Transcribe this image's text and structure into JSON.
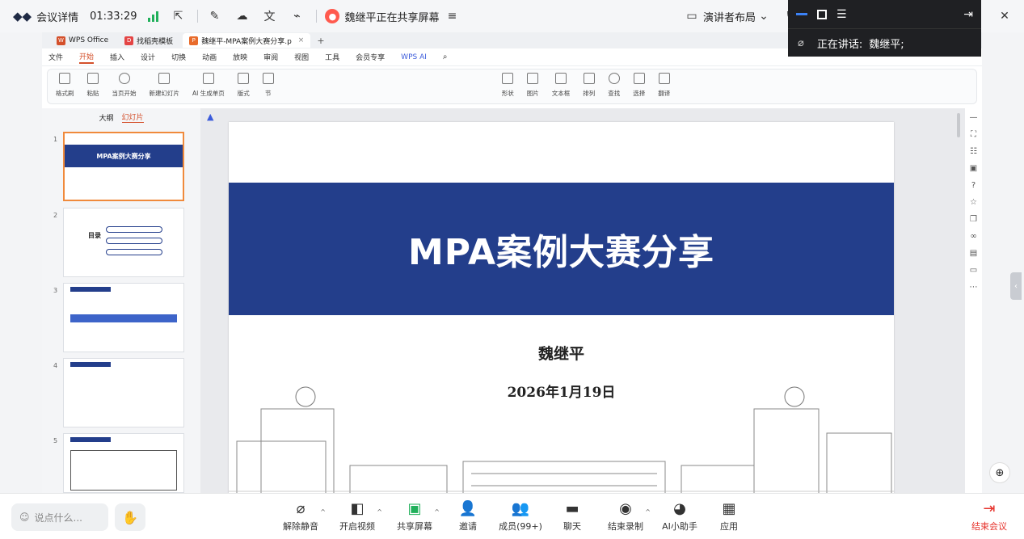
{
  "meeting": {
    "title": "会议详情",
    "timer": "01:33:29",
    "sharing_text": "魏继平正在共享屏幕",
    "layout_label": "演讲者布局",
    "speaking_label": "正在讲话:",
    "speaking_name": "魏继平;"
  },
  "wps": {
    "tabs": [
      {
        "label": "WPS Office",
        "icon_color": "#d4502b"
      },
      {
        "label": "找稻壳模板",
        "icon_color": "#e44545"
      },
      {
        "label": "魏继平-MPA案例大赛分享.p",
        "icon_color": "#e86b2b"
      }
    ],
    "menu": [
      "文件",
      "开始",
      "插入",
      "设计",
      "切换",
      "动画",
      "放映",
      "审阅",
      "视图",
      "工具",
      "会员专享",
      "WPS AI"
    ],
    "ribbon": [
      {
        "label": "格式刷"
      },
      {
        "label": "粘贴"
      },
      {
        "label": "当页开始"
      },
      {
        "label": "新建幻灯片"
      },
      {
        "label": "AI 生成单页"
      },
      {
        "label": "版式"
      },
      {
        "label": "节"
      },
      {
        "label": "形状"
      },
      {
        "label": "图片"
      },
      {
        "label": "文本框"
      },
      {
        "label": "排列"
      },
      {
        "label": "查找"
      },
      {
        "label": "选择"
      },
      {
        "label": "翻译"
      }
    ],
    "pane_tabs": {
      "outline": "大纲",
      "slides": "幻灯片"
    },
    "thumbs": [
      {
        "num": "1",
        "title": "MPA案例大赛分享"
      },
      {
        "num": "2",
        "title": "目录"
      },
      {
        "num": "3",
        "title": ""
      },
      {
        "num": "4",
        "title": ""
      },
      {
        "num": "5",
        "title": ""
      }
    ],
    "slide": {
      "title": "MPA案例大赛分享",
      "author": "魏继平",
      "date": "2026年1月19日"
    }
  },
  "bottom": {
    "chat_placeholder": "说点什么...",
    "controls": [
      {
        "label": "解除静音",
        "icon": "mic-off-icon"
      },
      {
        "label": "开启视频",
        "icon": "camera-off-icon"
      },
      {
        "label": "共享屏幕",
        "icon": "screen-share-icon"
      },
      {
        "label": "邀请",
        "icon": "invite-icon"
      },
      {
        "label": "成员(99+)",
        "icon": "members-icon"
      },
      {
        "label": "聊天",
        "icon": "chat-icon"
      },
      {
        "label": "结束录制",
        "icon": "record-icon"
      },
      {
        "label": "AI小助手",
        "icon": "ai-assistant-icon"
      },
      {
        "label": "应用",
        "icon": "apps-icon"
      }
    ],
    "end_label": "结束会议"
  }
}
